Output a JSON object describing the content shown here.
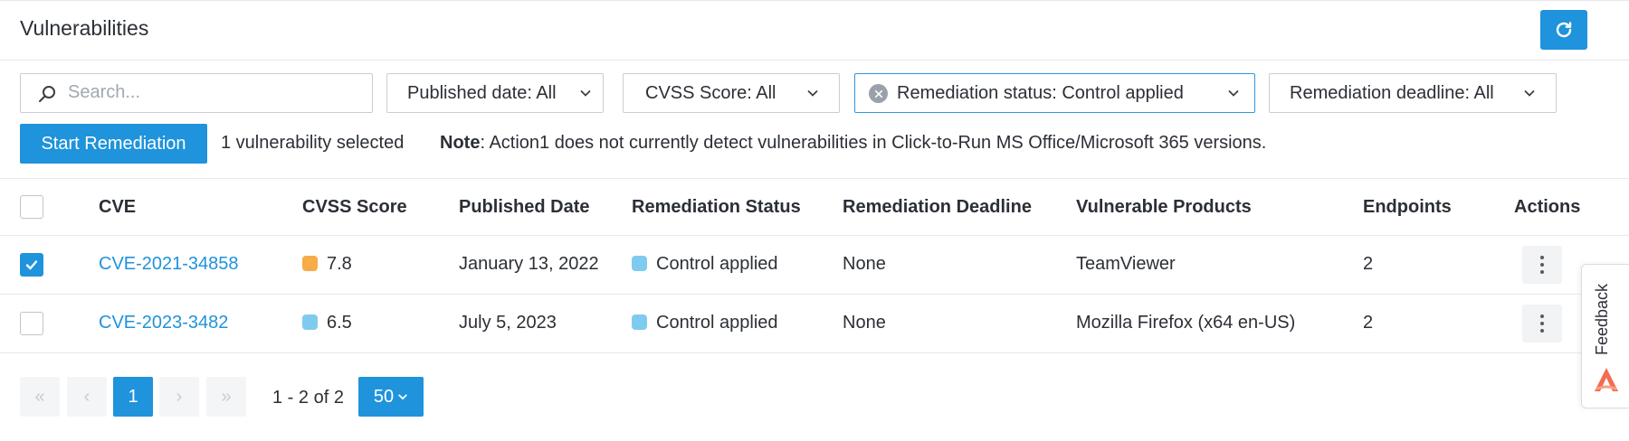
{
  "header": {
    "title": "Vulnerabilities",
    "refresh_icon": "refresh-icon"
  },
  "filters": {
    "search_placeholder": "Search...",
    "published_date": "Published date: All",
    "cvss_score": "CVSS Score: All",
    "remediation_status": "Remediation status: Control applied",
    "remediation_deadline": "Remediation deadline: All"
  },
  "actions": {
    "start_remediation": "Start Remediation",
    "selected_count": "1 vulnerability selected",
    "note_label": "Note",
    "note_text": ": Action1 does not currently detect vulnerabilities in Click-to-Run MS Office/Microsoft 365 versions."
  },
  "table": {
    "columns": [
      "CVE",
      "CVSS Score",
      "Published Date",
      "Remediation Status",
      "Remediation Deadline",
      "Vulnerable Products",
      "Endpoints",
      "Actions"
    ],
    "rows": [
      {
        "checked": true,
        "cve": "CVE-2021-34858",
        "cvss": "7.8",
        "cvss_color": "#f6ac47",
        "published": "January 13, 2022",
        "status": "Control applied",
        "status_color": "#7fcbf0",
        "deadline": "None",
        "product": "TeamViewer",
        "endpoints": "2"
      },
      {
        "checked": false,
        "cve": "CVE-2023-3482",
        "cvss": "6.5",
        "cvss_color": "#7fcbf0",
        "published": "July 5, 2023",
        "status": "Control applied",
        "status_color": "#7fcbf0",
        "deadline": "None",
        "product": "Mozilla Firefox (x64 en-US)",
        "endpoints": "2"
      }
    ]
  },
  "pagination": {
    "first": "«",
    "prev": "‹",
    "current_page": "1",
    "next": "›",
    "last": "»",
    "range": "1 - 2 of 2",
    "per_page": "50"
  },
  "feedback": {
    "label": "Feedback"
  },
  "colors": {
    "accent": "#1f93db",
    "border": "#e6e8ec"
  }
}
